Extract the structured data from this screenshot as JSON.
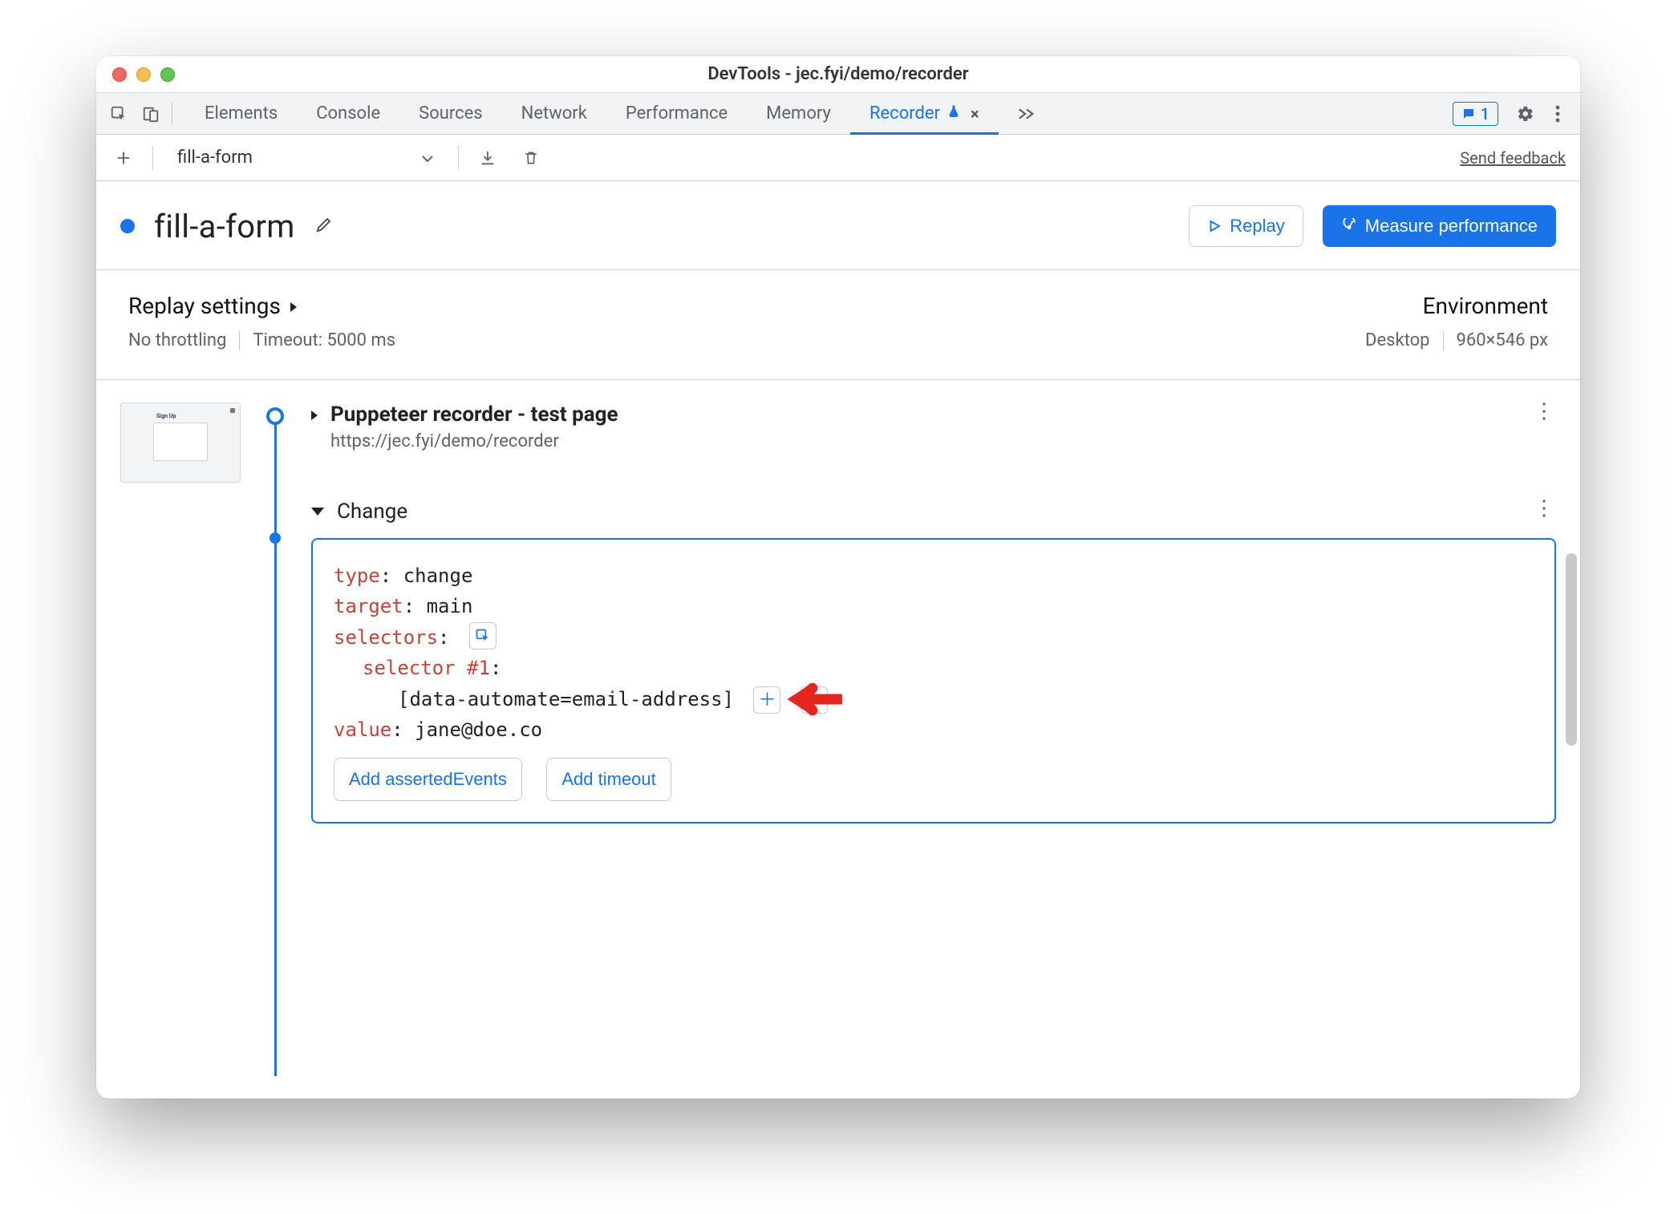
{
  "titlebar": {
    "title": "DevTools - jec.fyi/demo/recorder"
  },
  "tabs": {
    "items": [
      "Elements",
      "Console",
      "Sources",
      "Network",
      "Performance",
      "Memory",
      "Recorder"
    ],
    "active": "Recorder",
    "issues_count": "1"
  },
  "toolbar": {
    "recording_name": "fill-a-form",
    "feedback_label": "Send feedback"
  },
  "header": {
    "recording_title": "fill-a-form",
    "replay_label": "Replay",
    "measure_label": "Measure performance"
  },
  "settings": {
    "replay_heading": "Replay settings",
    "throttling": "No throttling",
    "timeout": "Timeout: 5000 ms",
    "env_heading": "Environment",
    "device": "Desktop",
    "viewport": "960×546 px"
  },
  "steps": {
    "nav": {
      "title": "Puppeteer recorder - test page",
      "url": "https://jec.fyi/demo/recorder"
    },
    "change": {
      "label": "Change",
      "type_key": "type",
      "type_val": "change",
      "target_key": "target",
      "target_val": "main",
      "selectors_key": "selectors",
      "selector_label": "selector #1",
      "selector_value": "[data-automate=email-address]",
      "value_key": "value",
      "value_val": "jane@doe.co",
      "add_asserted": "Add assertedEvents",
      "add_timeout": "Add timeout"
    }
  }
}
